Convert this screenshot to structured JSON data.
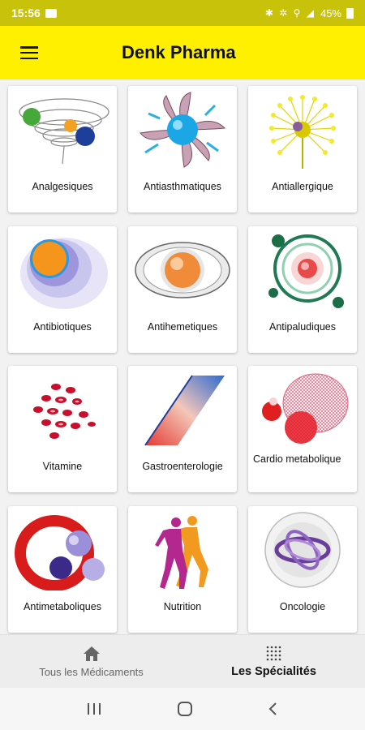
{
  "status_bar": {
    "time": "15:56",
    "icons": "✱ ✲ ⚲ ◢",
    "battery": "45%"
  },
  "app_bar": {
    "title": "Denk Pharma",
    "menu_icon": "hamburger-menu-icon"
  },
  "specialties": [
    {
      "label": "Analgesiques",
      "icon": "analgesic-swirl-icon"
    },
    {
      "label": "Antiasthmatiques",
      "icon": "antiasthma-fan-icon"
    },
    {
      "label": "Antiallergique",
      "icon": "dandelion-icon"
    },
    {
      "label": "Antibiotiques",
      "icon": "orange-cell-icon"
    },
    {
      "label": "Antihemetiques",
      "icon": "eye-sphere-icon"
    },
    {
      "label": "Antipaludiques",
      "icon": "orbit-icon"
    },
    {
      "label": "Vitamine",
      "icon": "blood-cells-icon"
    },
    {
      "label": "Gastroenterologie",
      "icon": "gradient-parallelogram-icon"
    },
    {
      "label": "Cardio metabolique",
      "icon": "net-spheres-icon"
    },
    {
      "label": "Antimetaboliques",
      "icon": "red-ring-spheres-icon"
    },
    {
      "label": "Nutrition",
      "icon": "runners-icon"
    },
    {
      "label": "Oncologie",
      "icon": "purple-rings-icon"
    }
  ],
  "bottom_nav": {
    "all_medicines": {
      "label": "Tous les Médicaments",
      "icon": "home-icon"
    },
    "specialties": {
      "label": "Les Spécialités",
      "icon": "grid-dots-icon"
    }
  },
  "colors": {
    "app_bar": "#fff000",
    "status_bar": "#c9c20a"
  }
}
